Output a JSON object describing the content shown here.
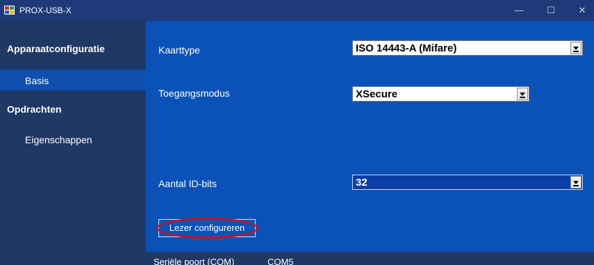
{
  "window": {
    "title": "PROX-USB-X",
    "min": "—",
    "max": "☐",
    "close": "✕"
  },
  "sidebar": {
    "items": [
      {
        "label": "Apparaatconfiguratie",
        "type": "header"
      },
      {
        "label": "Basis",
        "type": "sub",
        "selected": true
      },
      {
        "label": "Opdrachten",
        "type": "header"
      },
      {
        "label": "Eigenschappen",
        "type": "sub"
      }
    ]
  },
  "form": {
    "card_type_label": "Kaarttype",
    "card_type_value": "ISO 14443-A (Mifare)",
    "access_mode_label": "Toegangsmodus",
    "access_mode_value": "XSecure",
    "id_bits_label": "Aantal ID-bits",
    "id_bits_value": "32",
    "configure_button": "Lezer configureren"
  },
  "status": {
    "port_label": "Seriële poort (COM)",
    "port_value": "COM5"
  },
  "colors": {
    "main_bg": "#0a52b8",
    "sidebar_bg": "#1f3864",
    "highlight": "#d1101c"
  }
}
